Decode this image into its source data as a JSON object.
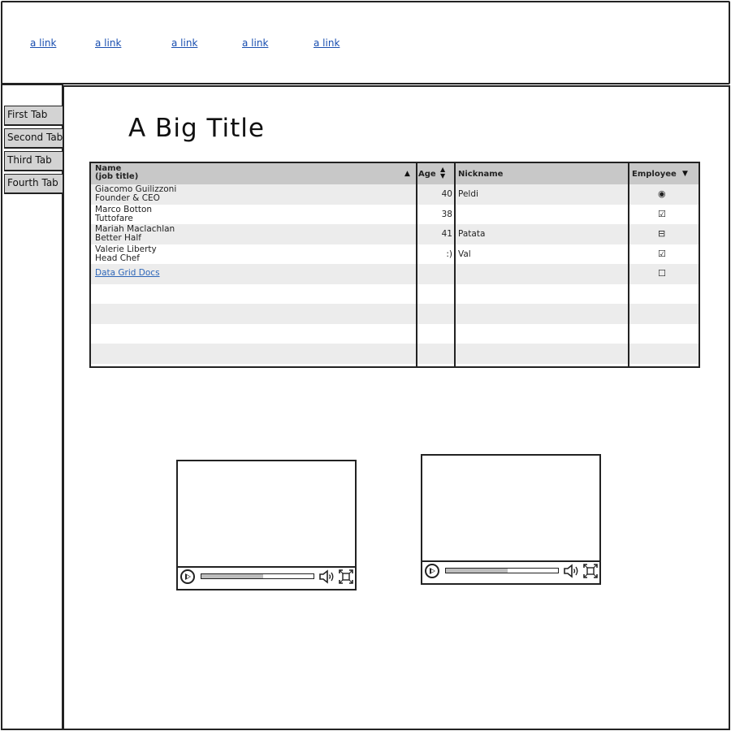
{
  "header": {
    "links": [
      "a link",
      "a link",
      "a link",
      "a link",
      "a link"
    ]
  },
  "sidebar": {
    "tabs": [
      "First Tab",
      "Second Tab",
      "Third Tab",
      "Fourth Tab"
    ]
  },
  "main": {
    "title": "A Big Title"
  },
  "grid": {
    "headers": {
      "name": "Name",
      "name_sub": "(job title)",
      "age": "Age",
      "nickname": "Nickname",
      "employee": "Employee"
    },
    "rows": [
      {
        "name": "Giacomo Guilizzoni",
        "title": "Founder & CEO",
        "age": "40",
        "nickname": "Peldi",
        "employee": "radio-selected"
      },
      {
        "name": "Marco Botton",
        "title": "Tuttofare",
        "age": "38",
        "nickname": "",
        "employee": "checked"
      },
      {
        "name": "Mariah Maclachlan",
        "title": "Better Half",
        "age": "41",
        "nickname": "Patata",
        "employee": "indeterminate"
      },
      {
        "name": "Valerie Liberty",
        "title": "Head Chef",
        "age": ":)",
        "nickname": "Val",
        "employee": "checked"
      }
    ],
    "link_row": {
      "label": "Data Grid Docs",
      "employee": "unchecked"
    },
    "sort": {
      "name": "ascending",
      "age": "both",
      "employee": "descending"
    }
  },
  "videos": [
    {
      "progress": 0.55
    },
    {
      "progress": 0.55
    }
  ],
  "icons": {
    "play": "play-icon",
    "volume": "volume-icon",
    "fullscreen": "fullscreen-icon"
  }
}
